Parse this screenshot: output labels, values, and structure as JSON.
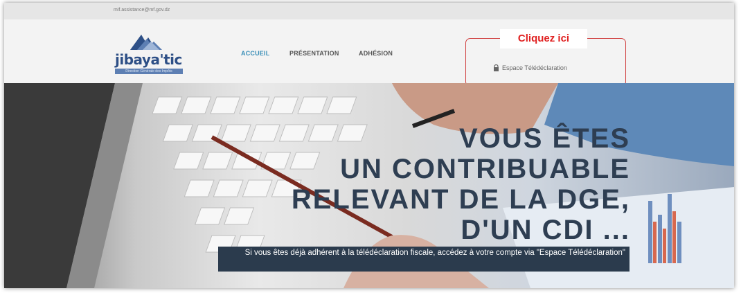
{
  "topbar": {
    "email": "mif.assistance@mf.gov.dz"
  },
  "logo": {
    "name": "jibaya'tic",
    "tagline": "Direction Générale des Impôts"
  },
  "nav": {
    "items": [
      {
        "label": "ACCUEIL"
      },
      {
        "label": "PRÉSENTATION"
      },
      {
        "label": "ADHÉSION"
      }
    ]
  },
  "callout": {
    "label": "Cliquez ici"
  },
  "espace": {
    "label": "Espace Télédéclaration"
  },
  "hero": {
    "headline": [
      "VOUS ÊTES",
      "UN CONTRIBUABLE",
      "RELEVANT DE LA DGE,",
      "D'UN CDI ..."
    ],
    "subtitle": "Si vous êtes déjà adhérent à la télédéclaration fiscale, accédez à votre compte via \"Espace Télédéclaration\""
  },
  "colors": {
    "accent": "#3b8fb8",
    "callout": "#e02020",
    "headline": "#2e3e52",
    "subtitle_bg": "#2b3b4d"
  }
}
